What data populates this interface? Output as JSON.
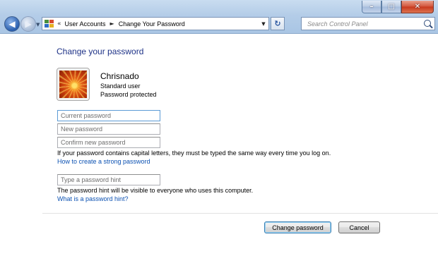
{
  "window": {
    "breadcrumb": {
      "overflow": "«",
      "items": [
        "User Accounts",
        "Change Your Password"
      ]
    },
    "search_placeholder": "Search Control Panel",
    "controls": {
      "minimize": "–",
      "maximize": "□",
      "close": "✕"
    }
  },
  "page": {
    "heading": "Change your password",
    "user": {
      "name": "Chrisnado",
      "type": "Standard user",
      "status": "Password protected"
    },
    "fields": {
      "current_placeholder": "Current password",
      "new_placeholder": "New password",
      "confirm_placeholder": "Confirm new password",
      "hint_placeholder": "Type a password hint"
    },
    "caps_notice": "If your password contains capital letters, they must be typed the same way every time you log on.",
    "strong_link": "How to create a strong password",
    "hint_notice": "The password hint will be visible to everyone who uses this computer.",
    "hint_link": "What is a password hint?",
    "buttons": {
      "change": "Change password",
      "cancel": "Cancel"
    }
  },
  "colors": {
    "heading": "#1e3287",
    "link": "#0b51b2",
    "titlebar": "#b4cde8"
  }
}
